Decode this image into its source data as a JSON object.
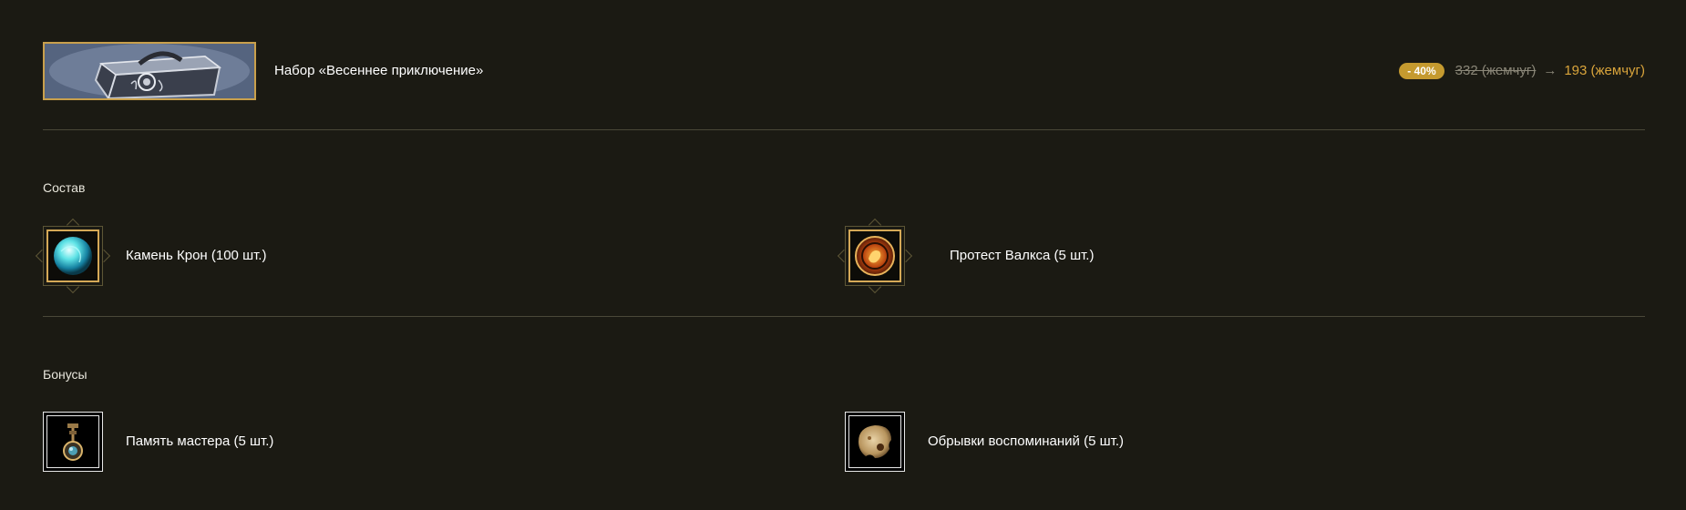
{
  "product": {
    "title": "Набор «Весеннее приключение»",
    "discount": "- 40%",
    "old_price": "332 (жемчуг)",
    "arrow": "→",
    "new_price": "193 (жемчуг)",
    "image_icon": "treasure-chest-icon"
  },
  "composition": {
    "title": "Состав",
    "items": [
      {
        "label": "Камень Крон (100 шт.)",
        "icon": "crown-stone-icon"
      },
      {
        "label": "Протест Валкса (5 шт.)",
        "icon": "valks-cry-icon"
      }
    ]
  },
  "bonuses": {
    "title": "Бонусы",
    "items": [
      {
        "label": "Память мастера (5 шт.)",
        "icon": "master-memory-icon"
      },
      {
        "label": "Обрывки воспоминаний (5 шт.)",
        "icon": "memory-fragment-icon"
      }
    ]
  },
  "colors": {
    "background": "#1b1a13",
    "accent_gold": "#d9a43b",
    "badge": "#c59a2f",
    "divider": "#4a4838"
  }
}
